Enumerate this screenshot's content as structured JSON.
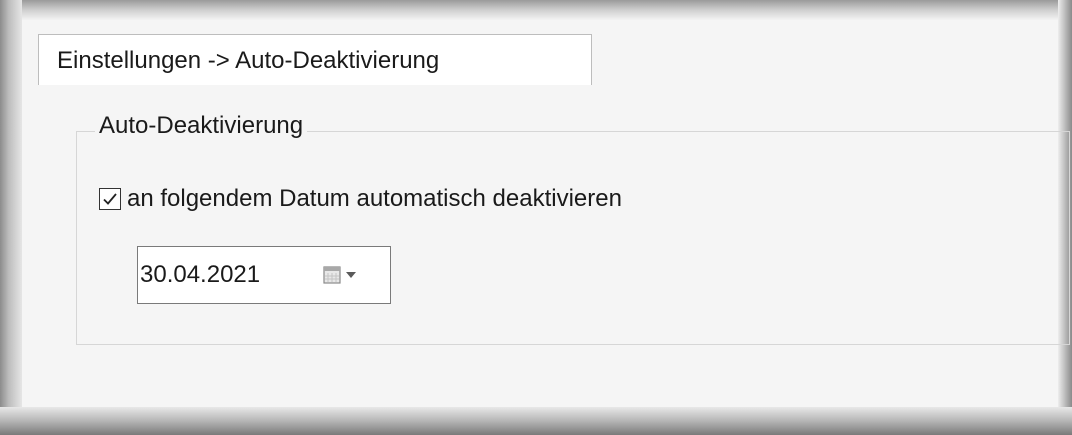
{
  "tab": {
    "label": "Einstellungen -> Auto-Deaktivierung"
  },
  "group": {
    "title": "Auto-Deaktivierung",
    "checkbox": {
      "label": "an folgendem Datum automatisch deaktivieren",
      "checked": true
    },
    "date_picker": {
      "value": "30.04.2021",
      "icon": "calendar-dropdown-icon"
    }
  },
  "colors": {
    "panel_background": "#f5f5f5",
    "border": "#d6d6d6",
    "text": "#1a1a1a"
  }
}
